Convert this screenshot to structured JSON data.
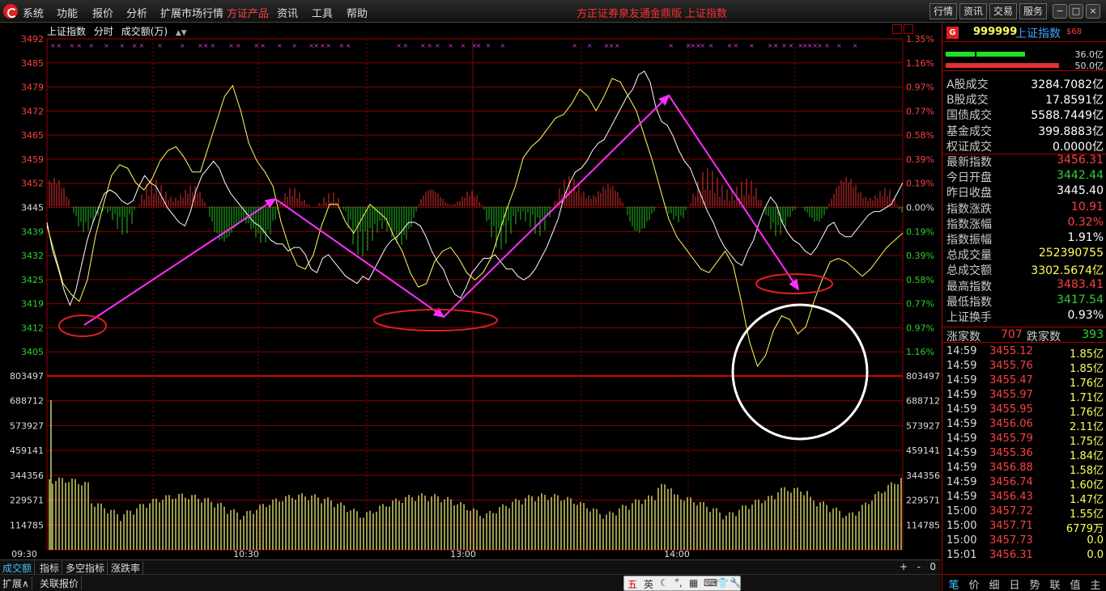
{
  "menu": {
    "items": [
      "系统",
      "功能",
      "报价",
      "分析",
      "扩展市场行情",
      "方证产品",
      "资讯",
      "工具",
      "帮助"
    ],
    "title_center": "方正证券泉友通金鼎版",
    "title_index": "上证指数",
    "right_buttons": [
      "行情",
      "资讯",
      "交易",
      "服务"
    ],
    "window_buttons": [
      "−",
      "□",
      "×"
    ]
  },
  "chart_header": {
    "name": "上证指数",
    "period": "分时",
    "metric": "成交额(万)"
  },
  "chart_data": {
    "type": "line",
    "price_axis_left": [
      "3492",
      "3485",
      "3479",
      "3472",
      "3465",
      "3459",
      "3452",
      "3445",
      "3439",
      "3432",
      "3425",
      "3419",
      "3412",
      "3405"
    ],
    "price_axis_right": [
      "1.35%",
      "1.16%",
      "0.97%",
      "0.77%",
      "0.58%",
      "0.39%",
      "0.19%",
      "0.00%",
      "0.19%",
      "0.39%",
      "0.58%",
      "0.77%",
      "0.97%",
      "1.16%"
    ],
    "volume_axis": [
      "803497",
      "688712",
      "573927",
      "459141",
      "344356",
      "229571",
      "114785"
    ],
    "time_labels": [
      "09:30",
      "10:30",
      "13:00",
      "14:00"
    ],
    "prev_close": 3445.4,
    "ylim": [
      3405,
      3492
    ],
    "series": [
      {
        "name": "white-index",
        "color": "#ffffff",
        "values": [
          3441,
          3433,
          3428,
          3422,
          3418,
          3422,
          3429,
          3436,
          3441,
          3445,
          3449,
          3450,
          3449,
          3447,
          3446,
          3447,
          3451,
          3454,
          3452,
          3451,
          3448,
          3445,
          3443,
          3441,
          3440,
          3444,
          3450,
          3454,
          3456,
          3458,
          3456,
          3452,
          3449,
          3447,
          3445,
          3443,
          3441,
          3440,
          3438,
          3436,
          3435,
          3435,
          3433,
          3434,
          3434,
          3432,
          3428,
          3427,
          3431,
          3432,
          3430,
          3428,
          3426,
          3425,
          3424,
          3426,
          3425,
          3428,
          3431,
          3434,
          3436,
          3437,
          3439,
          3441,
          3441,
          3440,
          3437,
          3433,
          3430,
          3428,
          3424,
          3421,
          3420,
          3423,
          3427,
          3429,
          3431,
          3431,
          3432,
          3430,
          3428,
          3428,
          3426,
          3425,
          3426,
          3428,
          3431,
          3434,
          3438,
          3442,
          3448,
          3452,
          3455,
          3456,
          3458,
          3461,
          3463,
          3464,
          3467,
          3470,
          3473,
          3476,
          3478,
          3482,
          3483,
          3480,
          3473,
          3469,
          3468,
          3465,
          3461,
          3458,
          3456,
          3452,
          3448,
          3444,
          3441,
          3437,
          3434,
          3432,
          3430,
          3429,
          3433,
          3436,
          3441,
          3445,
          3448,
          3446,
          3441,
          3438,
          3436,
          3435,
          3433,
          3432,
          3434,
          3437,
          3440,
          3441,
          3438,
          3437,
          3437,
          3439,
          3441,
          3443,
          3444,
          3444,
          3445,
          3446,
          3449,
          3452
        ]
      },
      {
        "name": "yellow-avg",
        "color": "#ffff60",
        "values": [
          3440,
          3432,
          3424,
          3421,
          3419,
          3425,
          3437,
          3446,
          3454,
          3457,
          3456,
          3452,
          3450,
          3453,
          3458,
          3461,
          3462,
          3459,
          3455,
          3455,
          3462,
          3469,
          3476,
          3479,
          3472,
          3463,
          3458,
          3455,
          3451,
          3441,
          3434,
          3429,
          3428,
          3432,
          3440,
          3446,
          3446,
          3441,
          3438,
          3442,
          3446,
          3444,
          3442,
          3437,
          3433,
          3427,
          3423,
          3424,
          3430,
          3433,
          3434,
          3431,
          3427,
          3425,
          3427,
          3431,
          3438,
          3445,
          3451,
          3459,
          3462,
          3464,
          3467,
          3470,
          3471,
          3474,
          3478,
          3476,
          3472,
          3476,
          3481,
          3480,
          3476,
          3472,
          3465,
          3458,
          3450,
          3442,
          3437,
          3434,
          3431,
          3428,
          3427,
          3430,
          3433,
          3429,
          3419,
          3408,
          3401,
          3404,
          3411,
          3415,
          3414,
          3410,
          3412,
          3419,
          3425,
          3430,
          3431,
          3430,
          3428,
          3426,
          3428,
          3431,
          3434,
          3436,
          3438
        ]
      }
    ],
    "volume_note": "bars in lower pane"
  },
  "index_info": {
    "badge": "G",
    "code": "999999",
    "name": "上证指数",
    "suffix": "$68",
    "bar_up_value": "36.0亿",
    "bar_down_value": "50.0亿"
  },
  "stats": [
    {
      "label": "A股成交",
      "value": "3284.7082亿",
      "color": "white"
    },
    {
      "label": "B股成交",
      "value": "17.8591亿",
      "color": "white"
    },
    {
      "label": "国债成交",
      "value": "5588.7449亿",
      "color": "white"
    },
    {
      "label": "基金成交",
      "value": "399.8883亿",
      "color": "white"
    },
    {
      "label": "权证成交",
      "value": "0.0000亿",
      "color": "white"
    },
    {
      "label": "最新指数",
      "value": "3456.31",
      "color": "red"
    },
    {
      "label": "今日开盘",
      "value": "3442.44",
      "color": "green"
    },
    {
      "label": "昨日收盘",
      "value": "3445.40",
      "color": "white"
    },
    {
      "label": "指数涨跌",
      "value": "10.91",
      "color": "red"
    },
    {
      "label": "指数涨幅",
      "value": "0.32%",
      "color": "red"
    },
    {
      "label": "指数振幅",
      "value": "1.91%",
      "color": "white"
    },
    {
      "label": "总成交量",
      "value": "252390755",
      "color": "yellow"
    },
    {
      "label": "总成交额",
      "value": "3302.5674亿",
      "color": "yellow"
    },
    {
      "label": "最高指数",
      "value": "3483.41",
      "color": "red"
    },
    {
      "label": "最低指数",
      "value": "3417.54",
      "color": "green"
    },
    {
      "label": "上证换手",
      "value": "0.93%",
      "color": "white"
    }
  ],
  "advdec": {
    "up_label": "涨家数",
    "up_value": "707",
    "down_label": "跌家数",
    "down_value": "393"
  },
  "ticks": [
    {
      "time": "14:59",
      "price": "3455.12",
      "vol": "1.85亿"
    },
    {
      "time": "14:59",
      "price": "3455.76",
      "vol": "1.85亿"
    },
    {
      "time": "14:59",
      "price": "3455.47",
      "vol": "1.76亿"
    },
    {
      "time": "14:59",
      "price": "3455.97",
      "vol": "1.71亿"
    },
    {
      "time": "14:59",
      "price": "3455.95",
      "vol": "1.76亿"
    },
    {
      "time": "14:59",
      "price": "3456.06",
      "vol": "2.11亿"
    },
    {
      "time": "14:59",
      "price": "3455.79",
      "vol": "1.75亿"
    },
    {
      "time": "14:59",
      "price": "3455.36",
      "vol": "1.84亿"
    },
    {
      "time": "14:59",
      "price": "3456.88",
      "vol": "1.58亿"
    },
    {
      "time": "14:59",
      "price": "3456.74",
      "vol": "1.60亿"
    },
    {
      "time": "14:59",
      "price": "3456.43",
      "vol": "1.47亿"
    },
    {
      "time": "15:00",
      "price": "3457.72",
      "vol": "1.55亿"
    },
    {
      "time": "15:00",
      "price": "3457.71",
      "vol": "6779万"
    },
    {
      "time": "15:00",
      "price": "3457.73",
      "vol": "0.0"
    },
    {
      "time": "15:01",
      "price": "3456.31",
      "vol": "0.0"
    }
  ],
  "panel_tabs": [
    "笔",
    "价",
    "细",
    "日",
    "势",
    "联",
    "值",
    "主"
  ],
  "bottom_tabs": [
    "成交额",
    "指标",
    "多空指标",
    "涨跌率"
  ],
  "bottom_right": [
    "+",
    "-",
    "0"
  ],
  "status_tabs": [
    "扩展∧",
    "关联报价"
  ],
  "ime": {
    "items": [
      "五",
      "英",
      "☾",
      "°,",
      "▦",
      "⌨",
      "👕",
      "🔧"
    ]
  }
}
